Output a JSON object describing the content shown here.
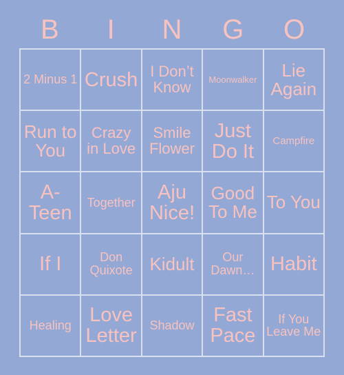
{
  "card": {
    "title": "BINGO",
    "background_color": "#93a8d4",
    "text_color": "#f7c2c0",
    "grid_line_color": "#d8e0f0"
  },
  "header": {
    "letters": [
      {
        "label": "B"
      },
      {
        "label": "I"
      },
      {
        "label": "N"
      },
      {
        "label": "G"
      },
      {
        "label": "O"
      }
    ]
  },
  "grid": {
    "columns": 5,
    "rows": 5,
    "cells": [
      {
        "label": "2 Minus 1",
        "size": "sm"
      },
      {
        "label": "Crush",
        "size": "xl"
      },
      {
        "label": "I Don’t Know",
        "size": "md"
      },
      {
        "label": "Moonwalker",
        "size": "xxs"
      },
      {
        "label": "Lie Again",
        "size": "lg"
      },
      {
        "label": "Run to You",
        "size": "lg"
      },
      {
        "label": "Crazy in Love",
        "size": "md"
      },
      {
        "label": "Smile Flower",
        "size": "md"
      },
      {
        "label": "Just Do It",
        "size": "xl"
      },
      {
        "label": "Campfire",
        "size": "xs"
      },
      {
        "label": "A-Teen",
        "size": "xl"
      },
      {
        "label": "Together",
        "size": "sm"
      },
      {
        "label": "Aju Nice!",
        "size": "xl"
      },
      {
        "label": "Good To Me",
        "size": "lg"
      },
      {
        "label": "To You",
        "size": "lg"
      },
      {
        "label": "If I",
        "size": "xl"
      },
      {
        "label": "Don Quixote",
        "size": "sm"
      },
      {
        "label": "Kidult",
        "size": "lg"
      },
      {
        "label": "Our Dawn…",
        "size": "sm"
      },
      {
        "label": "Habit",
        "size": "xl"
      },
      {
        "label": "Healing",
        "size": "sm"
      },
      {
        "label": "Love Letter",
        "size": "xl"
      },
      {
        "label": "Shadow",
        "size": "sm"
      },
      {
        "label": "Fast Pace",
        "size": "xl"
      },
      {
        "label": "If You Leave Me",
        "size": "sm"
      }
    ]
  }
}
